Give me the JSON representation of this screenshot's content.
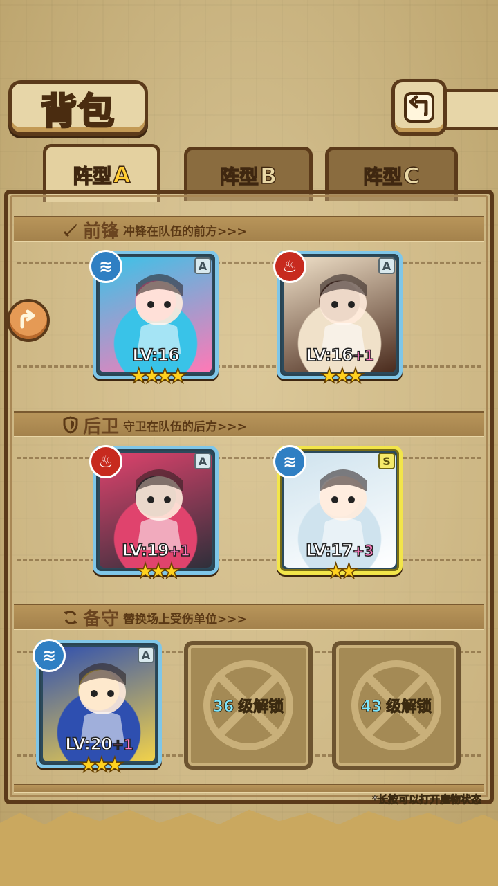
{
  "header": {
    "title": "背包",
    "back_icon": "return-arrow-icon"
  },
  "tabs": [
    {
      "label": "阵型",
      "suffix": "A",
      "active": true
    },
    {
      "label": "阵型",
      "suffix": "B",
      "active": false
    },
    {
      "label": "阵型",
      "suffix": "C",
      "active": false
    }
  ],
  "sections": {
    "front": {
      "icon": "sword-icon",
      "title": "前锋",
      "desc": "冲锋在队伍的前方>>>"
    },
    "back": {
      "icon": "shield-icon",
      "title": "后卫",
      "desc": "守卫在队伍的后方>>>"
    },
    "reserve": {
      "icon": "swap-icon",
      "title": "备守",
      "desc": "替换场上受伤单位>>>"
    }
  },
  "monsters": [
    {
      "slot": "front-1",
      "element": "water",
      "rank": "A",
      "level": "LV:16",
      "plus": "",
      "stars": "★★★★",
      "frame": "blue",
      "theme": [
        "#39c3e8",
        "#ff79b6"
      ]
    },
    {
      "slot": "front-2",
      "element": "fire",
      "rank": "A",
      "level": "LV:16",
      "plus": "+1",
      "stars": "★★★",
      "frame": "blue",
      "theme": [
        "#f0e1c9",
        "#4a2b1d"
      ]
    },
    {
      "slot": "back-1",
      "element": "fire",
      "rank": "A",
      "level": "LV:19",
      "plus": "+1",
      "stars": "★★★",
      "frame": "blue",
      "theme": [
        "#e0436d",
        "#2f2f3a"
      ]
    },
    {
      "slot": "back-2",
      "element": "water",
      "rank": "S",
      "level": "LV:17",
      "plus": "+3",
      "stars": "★★",
      "frame": "gold",
      "theme": [
        "#cfe3ee",
        "#ffffff"
      ]
    },
    {
      "slot": "reserve-1",
      "element": "water",
      "rank": "A",
      "level": "LV:20",
      "plus": "+1",
      "stars": "★★★",
      "frame": "blue",
      "theme": [
        "#2e4fb0",
        "#f2d24a"
      ]
    }
  ],
  "locked_slots": [
    {
      "level": "36",
      "text": "级解锁"
    },
    {
      "level": "43",
      "text": "级解锁"
    }
  ],
  "footer_note": "*长按可以打开魔物状态",
  "colors": {
    "wood_dark": "#5b3a1a",
    "parchment": "#e4d1a0",
    "water": "#2f7fc3",
    "fire": "#c72a1e",
    "gold_frame": "#f2e54a",
    "blue_frame": "#7fc6e8"
  }
}
